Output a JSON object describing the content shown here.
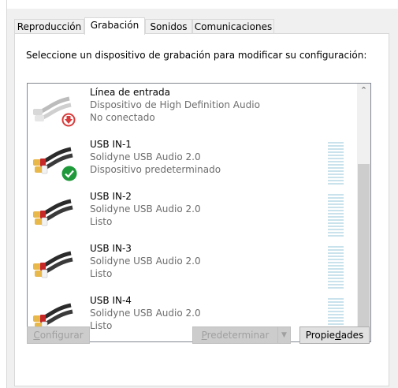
{
  "tabs": [
    {
      "label": "Reproducción",
      "active": false
    },
    {
      "label": "Grabación",
      "active": true
    },
    {
      "label": "Sonidos",
      "active": false
    },
    {
      "label": "Comunicaciones",
      "active": false
    }
  ],
  "instruction": "Seleccione un dispositivo de grabación para modificar su configuración:",
  "devices": [
    {
      "name": "Línea de entrada",
      "description": "Dispositivo de High Definition Audio",
      "status": "No conectado",
      "badge": "red-down-arrow-icon",
      "cable": "gray",
      "meter": false
    },
    {
      "name": "USB IN-1",
      "description": "Solidyne USB Audio 2.0",
      "status": "Dispositivo predeterminado",
      "badge": "green-check-icon",
      "cable": "black",
      "meter": true
    },
    {
      "name": "USB IN-2",
      "description": "Solidyne USB Audio 2.0",
      "status": "Listo",
      "badge": "",
      "cable": "black",
      "meter": true
    },
    {
      "name": "USB IN-3",
      "description": "Solidyne USB Audio 2.0",
      "status": "Listo",
      "badge": "",
      "cable": "black",
      "meter": true
    },
    {
      "name": "USB IN-4",
      "description": "Solidyne USB Audio 2.0",
      "status": "Listo",
      "badge": "",
      "cable": "black",
      "meter": true
    }
  ],
  "buttons": {
    "configure": {
      "pre": "",
      "underline": "C",
      "post": "onfigurar",
      "enabled": false
    },
    "set_default": {
      "pre": "",
      "underline": "P",
      "post": "redeterminar",
      "enabled": false
    },
    "properties": {
      "pre": "Propie",
      "underline": "d",
      "post": "ades",
      "enabled": true
    }
  },
  "colors": {
    "check_green": "#1e9a3a",
    "not_connected_red": "#d83b3b",
    "meter_blue": "#c9e2ec",
    "disabled_text": "#a0a0a0"
  }
}
